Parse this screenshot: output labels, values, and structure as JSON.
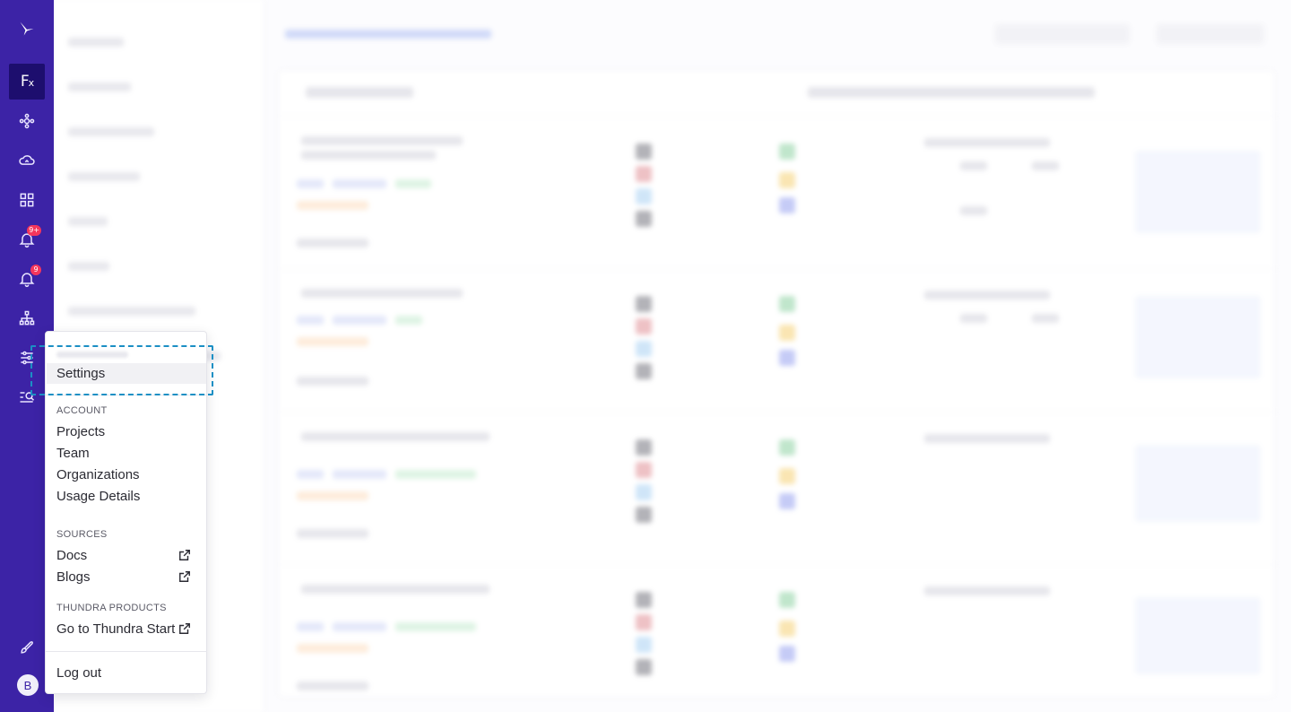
{
  "rail": {
    "logo_icon": "bird-logo-icon",
    "items": [
      {
        "name": "functions",
        "label": "F",
        "sub": "x"
      },
      {
        "name": "architecture",
        "icon": "network-icon"
      },
      {
        "name": "cloud",
        "icon": "cloud-sync-icon"
      },
      {
        "name": "dashboards",
        "icon": "grid-icon"
      },
      {
        "name": "alerts",
        "icon": "bell-alert-icon",
        "badge": "9+"
      },
      {
        "name": "notifications",
        "icon": "bell-icon",
        "badge": "9"
      },
      {
        "name": "topology",
        "icon": "sitemap-icon"
      },
      {
        "name": "filters",
        "icon": "sliders-icon"
      },
      {
        "name": "search",
        "icon": "list-search-icon"
      },
      {
        "name": "get-started",
        "icon": "rocket-icon"
      }
    ],
    "avatar_initial": "B"
  },
  "menu": {
    "settings_label": "Settings",
    "account_heading": "ACCOUNT",
    "account_items": [
      "Projects",
      "Team",
      "Organizations",
      "Usage Details"
    ],
    "sources_heading": "SOURCES",
    "docs_label": "Docs",
    "blogs_label": "Blogs",
    "products_heading": "THUNDRA PRODUCTS",
    "thundra_start_label": "Go to Thundra Start",
    "logout_label": "Log out"
  },
  "colors": {
    "rail": "#3c23a6",
    "rail_active": "#1d0e6e",
    "highlight": "#1b8fc4",
    "badge": "#f5365c"
  }
}
